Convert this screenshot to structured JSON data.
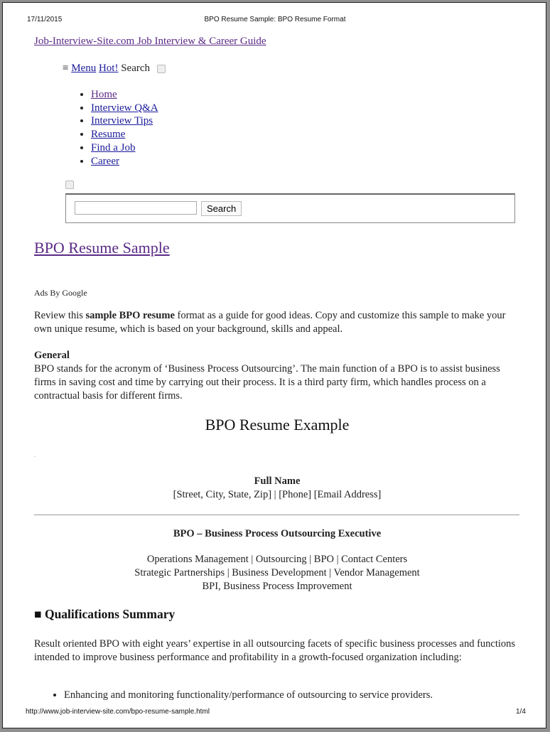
{
  "print_header": {
    "date": "17/11/2015",
    "title": "BPO Resume Sample: BPO Resume Format"
  },
  "site_link": "Job-Interview-Site.com Job Interview & Career Guide",
  "topnav": {
    "menu_icon": "≡",
    "menu": "Menu",
    "hot": "Hot!",
    "search_label": "Search"
  },
  "nav_items": [
    "Home",
    "Interview Q&A",
    "Interview Tips",
    "Resume",
    "Find a Job",
    "Career"
  ],
  "search": {
    "input_value": "",
    "button_label": "Search"
  },
  "article": {
    "title": "BPO Resume Sample",
    "ads": "Ads By Google",
    "intro_pre": "Review this ",
    "intro_bold": "sample BPO resume",
    "intro_post": " format as a guide for good ideas. Copy and customize this sample to make your own unique resume, which is based on your background, skills and appeal.",
    "general_heading": "General",
    "general_text": "BPO stands for the acronym of ‘Business Process Outsourcing’. The main function of a BPO is to assist business firms in saving cost and time by carrying out their process. It is a third party firm, which handles process on a contractual basis for different firms.",
    "example_heading": "BPO Resume Example",
    "dot": ".",
    "full_name": "Full Name",
    "contact": "[Street, City, State, Zip] | [Phone] [Email Address]",
    "role": "BPO – Business Process Outsourcing Executive",
    "skills": [
      "Operations Management | Outsourcing | BPO | Contact Centers",
      "Strategic Partnerships | Business Development | Vendor Management",
      "BPI, Business Process Improvement"
    ],
    "qual_icon": "■",
    "qual_heading": "Qualifications Summary",
    "qual_text": "Result oriented BPO with eight years’ expertise in all outsourcing facets of specific business processes and functions intended to improve business performance and profitability in a growth-focused organization including:",
    "qual_bullets": [
      "Enhancing and monitoring functionality/performance of outsourcing to service providers."
    ]
  },
  "print_footer": {
    "url": "http://www.job-interview-site.com/bpo-resume-sample.html",
    "page": "1/4"
  }
}
